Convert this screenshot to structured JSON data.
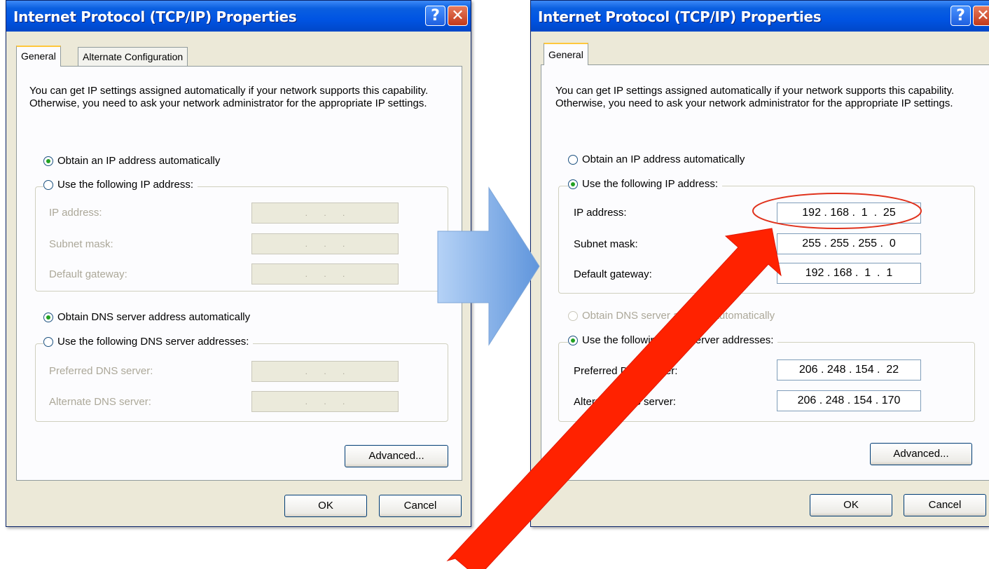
{
  "colors": {
    "arrow_blue": "#8db4e8",
    "arrow_red": "#ff2200",
    "highlight": "#e0321c",
    "titlebar": "#0054e3"
  },
  "left": {
    "title": "Internet Protocol (TCP/IP) Properties",
    "tabs": [
      "General",
      "Alternate Configuration"
    ],
    "description": "You can get IP settings assigned automatically if your network supports this capability. Otherwise, you need to ask your network administrator for the appropriate IP settings.",
    "obtain_ip_auto": "Obtain an IP address automatically",
    "use_ip": "Use the following IP address:",
    "ip_address_label": "IP address:",
    "subnet_mask_label": "Subnet mask:",
    "gateway_label": "Default gateway:",
    "ip_address": ".       .       .",
    "subnet_mask": ".       .       .",
    "gateway": ".       .       .",
    "obtain_dns_auto": "Obtain DNS server address automatically",
    "use_dns": "Use the following DNS server addresses:",
    "preferred_dns_label": "Preferred DNS server:",
    "alternate_dns_label": "Alternate DNS server:",
    "preferred_dns": ".       .       .",
    "alternate_dns": ".       .       .",
    "advanced": "Advanced...",
    "ok": "OK",
    "cancel": "Cancel"
  },
  "right": {
    "title": "Internet Protocol (TCP/IP) Properties",
    "tabs": [
      "General"
    ],
    "description": "You can get IP settings assigned automatically if your network supports this capability. Otherwise, you need to ask your network administrator for the appropriate IP settings.",
    "obtain_ip_auto": "Obtain an IP address automatically",
    "use_ip": "Use the following IP address:",
    "ip_address_label": "IP address:",
    "subnet_mask_label": "Subnet mask:",
    "gateway_label": "Default gateway:",
    "ip_address": "192 . 168 .  1  .  25",
    "subnet_mask": "255 . 255 . 255 .  0",
    "gateway": "192 . 168 .  1  .  1",
    "obtain_dns_auto": "Obtain DNS server address automatically",
    "use_dns": "Use the following DNS server addresses:",
    "preferred_dns_label": "Preferred DNS server:",
    "alternate_dns_label": "Alternate DNS server:",
    "preferred_dns": "206 . 248 . 154 .  22",
    "alternate_dns": "206 . 248 . 154 . 170",
    "advanced": "Advanced...",
    "ok": "OK",
    "cancel": "Cancel"
  }
}
